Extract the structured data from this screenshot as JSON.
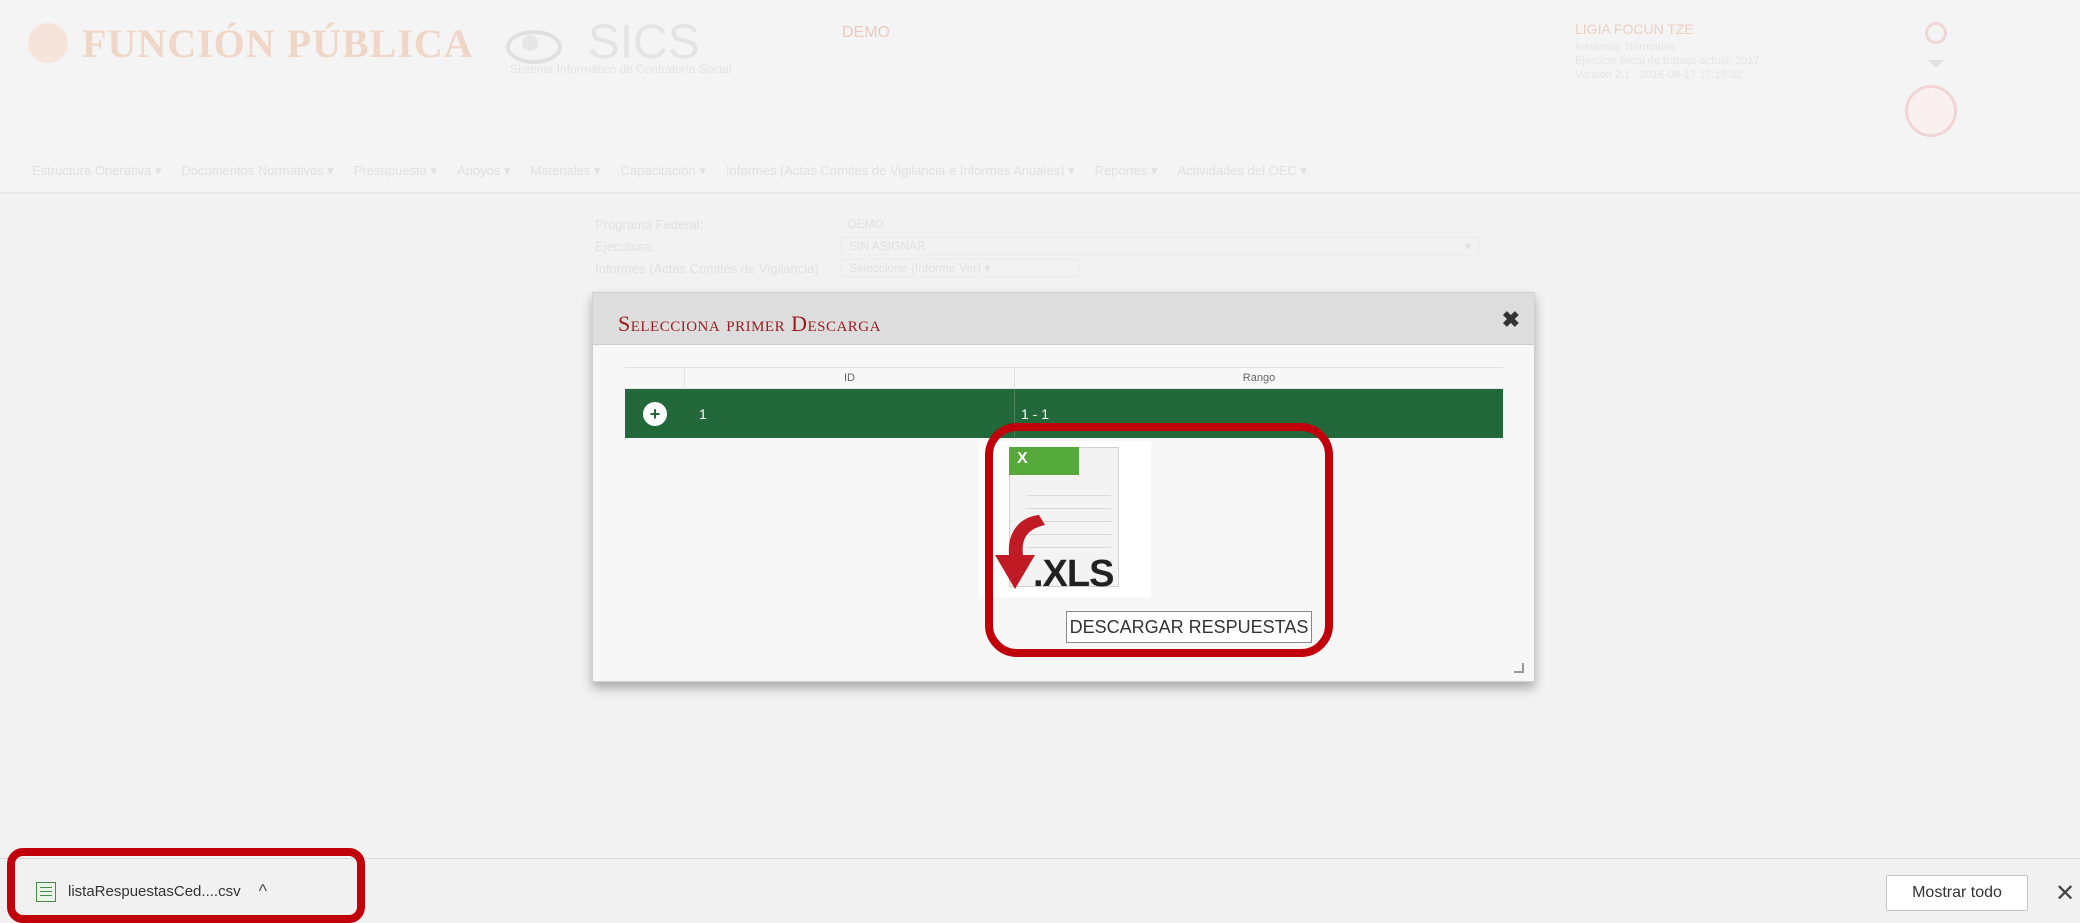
{
  "header": {
    "brand": "FUNCIÓN PÚBLICA",
    "system": "SICS",
    "system_subtitle": "Sistema Informático de Contraloría Social",
    "program": "DEMO",
    "user": {
      "name": "LIGIA FOCUN TZE",
      "line1": "Instancia: Normativa",
      "line2": "Ejercicio fiscal de trabajo actual: 2017",
      "line3": "Versión 2.1 - 2016-06-17 17:15:32"
    }
  },
  "nav": {
    "items": [
      "Estructura Operativa ▾",
      "Documentos Normativos ▾",
      "Presupuesto ▾",
      "Apoyos ▾",
      "Materiales ▾",
      "Capacitación ▾",
      "Informes (Actas Comités de Vigilancia e Informes Anuales) ▾",
      "Reportes ▾",
      "Actividades del OEC ▾"
    ]
  },
  "form": {
    "fields": [
      {
        "label": "Programa Federal:",
        "value": "DEMO"
      },
      {
        "label": "Ejecutora:",
        "value": "SIN ASIGNAR",
        "caret": "▾"
      },
      {
        "label": "Informes (Actas Comités de Vigilancia)",
        "value": "Seleccione (Informe Ver) ▾"
      }
    ]
  },
  "modal": {
    "title": "Selecciona primer Descarga",
    "close": "✖",
    "columns": [
      "ID",
      "Rango"
    ],
    "rows": [
      {
        "expand": "+",
        "id": "1",
        "range": "1 - 1"
      }
    ],
    "xls_label": ".XLS",
    "xls_tab": "X",
    "tooltip": "DESCARGAR RESPUESTAS"
  },
  "download_bar": {
    "filename": "listaRespuestasCed....csv",
    "chevron": "^",
    "show_all": "Mostrar todo",
    "close": "✕"
  },
  "colors": {
    "accent_red": "#9b1b1e",
    "row_green": "#23683a",
    "highlight": "#c0000b"
  }
}
